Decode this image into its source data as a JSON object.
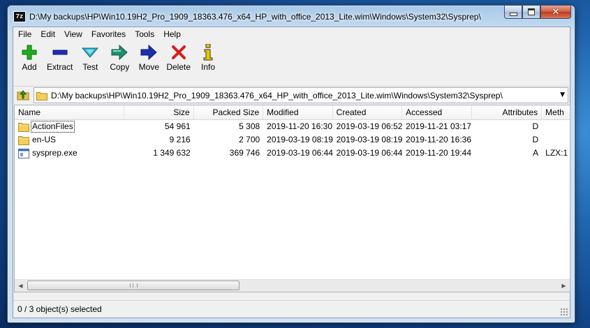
{
  "window": {
    "title": "D:\\My backups\\HP\\Win10.19H2_Pro_1909_18363.476_x64_HP_with_office_2013_Lite.wim\\Windows\\System32\\Sysprep\\",
    "app_icon_text": "7z",
    "close_glyph": "✕"
  },
  "menu": [
    "File",
    "Edit",
    "View",
    "Favorites",
    "Tools",
    "Help"
  ],
  "toolbar": [
    {
      "label": "Add",
      "icon": "plus-icon",
      "color": "#1fae1f"
    },
    {
      "label": "Extract",
      "icon": "minus-icon",
      "color": "#1c2fb0"
    },
    {
      "label": "Test",
      "icon": "check-icon",
      "color": "#2ab0c8"
    },
    {
      "label": "Copy",
      "icon": "copy-arrow-icon",
      "color": "#1f8f6f"
    },
    {
      "label": "Move",
      "icon": "move-arrow-icon",
      "color": "#1c2fb0"
    },
    {
      "label": "Delete",
      "icon": "delete-x-icon",
      "color": "#d81c1c"
    },
    {
      "label": "Info",
      "icon": "info-icon",
      "color": "#e8c800"
    }
  ],
  "address": {
    "path": "D:\\My backups\\HP\\Win10.19H2_Pro_1909_18363.476_x64_HP_with_office_2013_Lite.wim\\Windows\\System32\\Sysprep\\",
    "dropdown_glyph": "▼"
  },
  "columns": [
    "Name",
    "Size",
    "Packed Size",
    "Modified",
    "Created",
    "Accessed",
    "Attributes",
    "Meth"
  ],
  "files": [
    {
      "name": "ActionFiles",
      "type": "folder",
      "size": "54 961",
      "packed": "5 308",
      "modified": "2019-11-20 16:30",
      "created": "2019-03-19 06:52",
      "accessed": "2019-11-21 03:17",
      "attributes": "D",
      "method": ""
    },
    {
      "name": "en-US",
      "type": "folder",
      "size": "9 216",
      "packed": "2 700",
      "modified": "2019-03-19 08:19",
      "created": "2019-03-19 08:19",
      "accessed": "2019-11-20 16:36",
      "attributes": "D",
      "method": ""
    },
    {
      "name": "sysprep.exe",
      "type": "exe",
      "size": "1 349 632",
      "packed": "369 746",
      "modified": "2019-03-19 06:44",
      "created": "2019-03-19 06:44",
      "accessed": "2019-11-20 19:44",
      "attributes": "A",
      "method": "LZX:1"
    }
  ],
  "scroll": {
    "left_glyph": "◀",
    "right_glyph": "▶"
  },
  "status": {
    "text": "0 / 3 object(s) selected"
  }
}
